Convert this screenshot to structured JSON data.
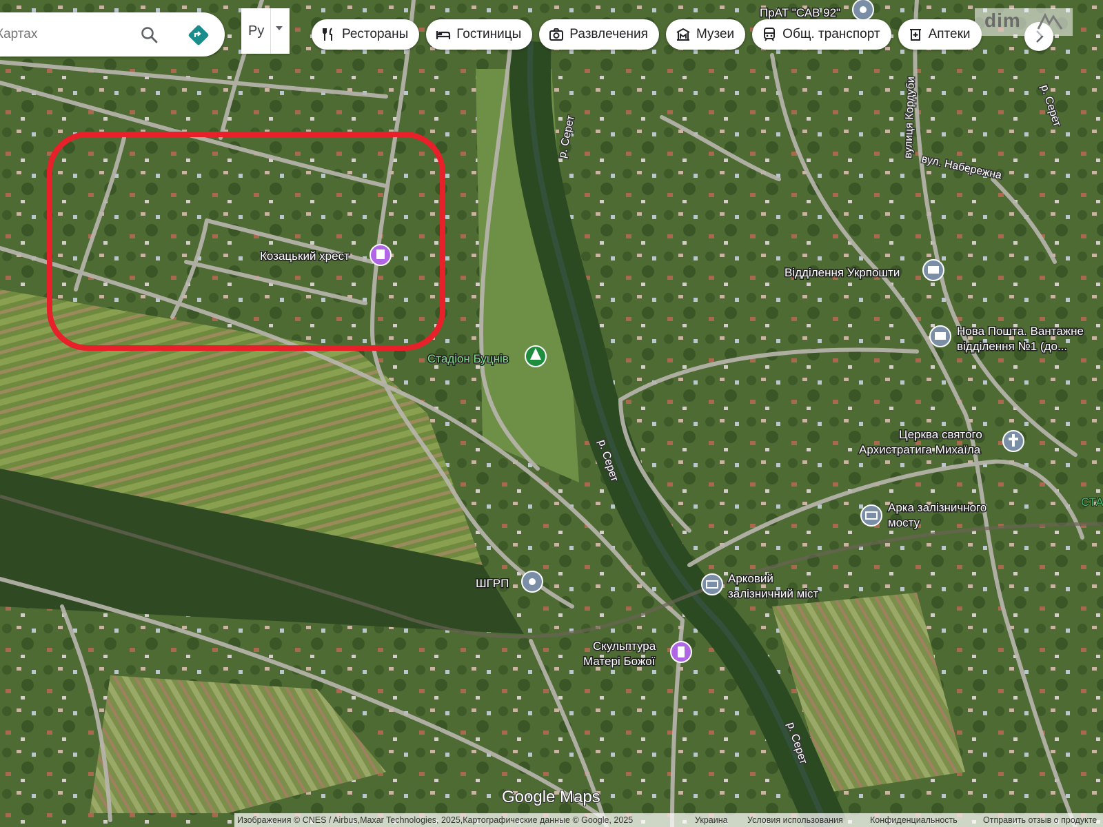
{
  "search": {
    "placeholder": "Картах"
  },
  "language": {
    "value": "Ру"
  },
  "categories": [
    {
      "label": "Рестораны",
      "icon": "fork-knife-icon"
    },
    {
      "label": "Гостиницы",
      "icon": "bed-icon"
    },
    {
      "label": "Развлечения",
      "icon": "camera-icon"
    },
    {
      "label": "Музеи",
      "icon": "museum-icon"
    },
    {
      "label": "Общ. транспорт",
      "icon": "train-icon"
    },
    {
      "label": "Аптеки",
      "icon": "pharmacy-icon"
    }
  ],
  "places": [
    {
      "name": "Козацький хрест",
      "kind": "monument",
      "color": "#b166e6"
    },
    {
      "name": "Стадіон Буцнів",
      "kind": "park",
      "color": "#1e8e3e"
    },
    {
      "name": "Відділення Укрпошти",
      "kind": "post",
      "color": "#7a8fa6"
    },
    {
      "name": "Нова Пошта. Вантажне відділення №1 (до...",
      "kind": "post",
      "color": "#7a8fa6"
    },
    {
      "name": "Церква святого Архистратига Михаїла",
      "kind": "church",
      "color": "#7a8fa6"
    },
    {
      "name": "Арка залізничного мосту",
      "kind": "landmark",
      "color": "#7a8fa6"
    },
    {
      "name": "Арковий залізничний міст",
      "kind": "landmark",
      "color": "#7a8fa6"
    },
    {
      "name": "ШГРП",
      "kind": "pin",
      "color": "#7a8fa6"
    },
    {
      "name": "Скульптура Матері Божої",
      "kind": "monument",
      "color": "#b166e6"
    },
    {
      "name": "ПрАТ \"САВ 92\"",
      "kind": "pin",
      "color": "#7a8fa6"
    }
  ],
  "streets": {
    "river": "р. Серет",
    "kordub": "вулиця Кордуби",
    "naberezhna": "вул. Набережна",
    "partial_right": "СТА"
  },
  "branding": {
    "google_maps": "Google Maps",
    "watermark": "dim"
  },
  "footer": {
    "attribution": "Изображения © CNES / Airbus,Maxar Technologies, 2025,Картографические данные © Google, 2025",
    "country": "Украина",
    "terms": "Условия использования",
    "privacy": "Конфиденциальность",
    "feedback": "Отправить отзыв о продукте"
  },
  "highlight": {
    "color": "#e8202a"
  }
}
